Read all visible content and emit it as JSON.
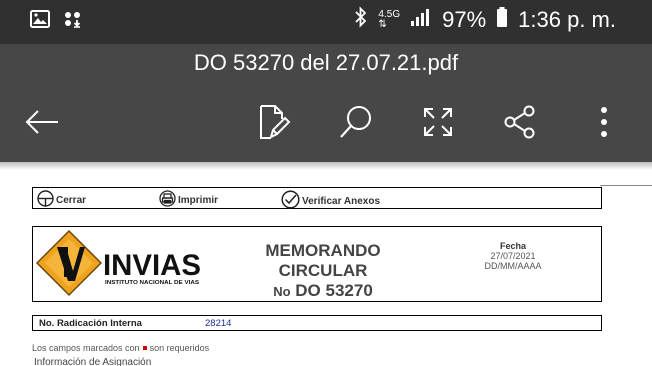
{
  "status_bar": {
    "icons": [
      "image-icon",
      "voicemail-download-icon",
      "bluetooth-icon",
      "network-4g-icon",
      "signal-icon",
      "battery-icon"
    ],
    "network_type": "4.5G",
    "battery_percent": "97%",
    "time": "1:36 p. m."
  },
  "title_bar": {
    "document_name": "DO 53270 del 27.07.21.pdf",
    "background": "#474747",
    "toolbar_icons": [
      "back-arrow-icon",
      "edit-document-icon",
      "search-icon",
      "fullscreen-icon",
      "share-icon",
      "more-vert-icon"
    ]
  },
  "document": {
    "actions": [
      {
        "label": "Cerrar",
        "icon": "close-circle-icon"
      },
      {
        "label": "Imprimir",
        "icon": "print-icon"
      },
      {
        "label": "Verificar Anexos",
        "icon": "check-circle-icon"
      }
    ],
    "logo": {
      "name": "INVIAS",
      "subtitle": "INSTITUTO NACIONAL DE VIAS",
      "colors": {
        "diamond": "#f0a21e",
        "dark": "#111111"
      }
    },
    "memo": {
      "line1": "MEMORANDO",
      "line2": "CIRCULAR",
      "no_prefix": "No",
      "number": "DO 53270"
    },
    "fecha": {
      "label": "Fecha",
      "value": "27/07/2021",
      "format": "DD/MM/AAAA"
    },
    "radicacion": {
      "label": "No. Radicación Interna",
      "value": "28214"
    },
    "required_note": {
      "prefix": "Los campos marcados con",
      "suffix": "son requeridos",
      "marker_color": "#d00000"
    },
    "section_title": "Información de Asignación"
  }
}
